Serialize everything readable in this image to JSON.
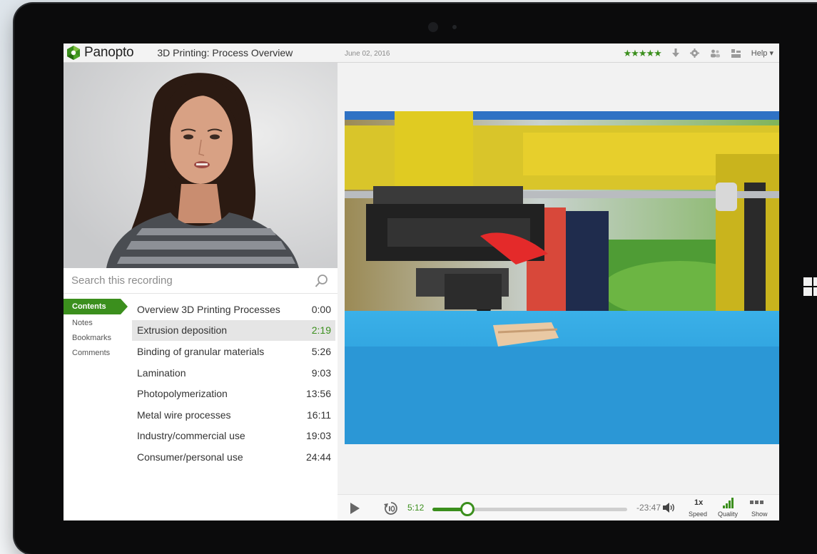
{
  "app": {
    "logo_text": "Panopto",
    "title": "3D Printing: Process Overview",
    "date": "June 02, 2016",
    "rating_stars": "★★★★★",
    "help_label": "Help ▾"
  },
  "search": {
    "placeholder": "Search this recording"
  },
  "tabs": [
    {
      "label": "Contents",
      "active": true
    },
    {
      "label": "Notes"
    },
    {
      "label": "Bookmarks"
    },
    {
      "label": "Comments"
    }
  ],
  "contents": [
    {
      "title": "Overview 3D Printing Processes",
      "time": "0:00"
    },
    {
      "title": "Extrusion deposition",
      "time": "2:19",
      "active": true
    },
    {
      "title": "Binding of granular materials",
      "time": "5:26"
    },
    {
      "title": "Lamination",
      "time": "9:03"
    },
    {
      "title": "Photopolymerization",
      "time": "13:56"
    },
    {
      "title": "Metal wire processes",
      "time": "16:11"
    },
    {
      "title": "Industry/commercial use",
      "time": "19:03"
    },
    {
      "title": "Consumer/personal use",
      "time": "24:44"
    }
  ],
  "player": {
    "current_time": "5:12",
    "remaining_time": "-23:47",
    "progress": 0.18,
    "speed_value": "1x",
    "speed_label": "Speed",
    "quality_label": "Quality",
    "show_label": "Show"
  },
  "colors": {
    "accent": "#3b8f1d",
    "active_row": "#e5e5e5"
  },
  "icons": [
    "download-icon",
    "settings-icon",
    "people-icon",
    "layout-icon",
    "search-icon",
    "play-icon",
    "rewind-10-icon",
    "volume-icon",
    "quality-icon",
    "show-icon",
    "windows-logo-icon"
  ]
}
